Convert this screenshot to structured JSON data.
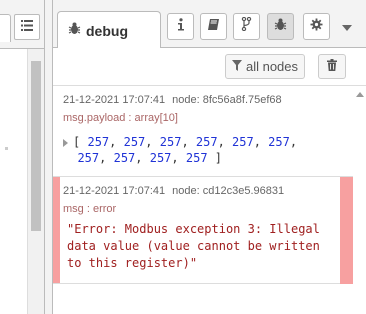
{
  "sidebar": {
    "tab": {
      "label": "debug",
      "icon": "bug-icon"
    },
    "buttons": [
      {
        "name": "info-button",
        "icon": "info-icon"
      },
      {
        "name": "help-button",
        "icon": "book-icon"
      },
      {
        "name": "context-button",
        "icon": "branch-icon"
      },
      {
        "name": "debug-button",
        "icon": "bug-icon",
        "active": true
      },
      {
        "name": "config-button",
        "icon": "gear-icon"
      }
    ],
    "filter_label": "all nodes"
  },
  "messages": [
    {
      "timestamp": "21-12-2021 17:07:41",
      "node": "node: 8fc56a8f.75ef68",
      "topic": "msg.payload : array[10]",
      "payload_open": "[",
      "payload_close": "]",
      "values": [
        "257",
        "257",
        "257",
        "257",
        "257",
        "257",
        "257",
        "257",
        "257",
        "257"
      ]
    },
    {
      "timestamp": "21-12-2021 17:07:41",
      "node": "node: cd12c3e5.96831",
      "topic": "msg : error",
      "error": "\"Error: Modbus exception 3: Illegal\ndata value (value cannot be written\nto this register)\""
    }
  ],
  "colors": {
    "error_stripe": "#f7a0a0",
    "number": "#2033d6",
    "error_text": "#a02020"
  }
}
